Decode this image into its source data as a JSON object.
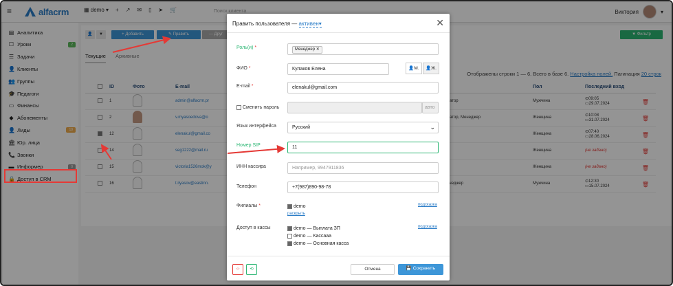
{
  "topbar": {
    "logo_text": "alfacrm",
    "branch": "demo",
    "branch_caret": "▾",
    "tools": [
      "+",
      "↗",
      "✉",
      "▯",
      "➤",
      "🛒"
    ],
    "search_placeholder": "Поиск клиента",
    "user_name": "Виктория",
    "user_caret": "▾"
  },
  "sidebar": {
    "items": [
      {
        "icon": "▤",
        "label": "Аналитика"
      },
      {
        "icon": "☐",
        "label": "Уроки",
        "badge": "2",
        "badge_color": "#5cb85c"
      },
      {
        "icon": "☰",
        "label": "Задачи"
      },
      {
        "icon": "👤",
        "label": "Клиенты"
      },
      {
        "icon": "👥",
        "label": "Группы"
      },
      {
        "icon": "🎓",
        "label": "Педагоги"
      },
      {
        "icon": "▭",
        "label": "Финансы"
      },
      {
        "icon": "◆",
        "label": "Абонементы"
      },
      {
        "icon": "👤",
        "label": "Лиды",
        "badge": "19",
        "badge_color": "#f0ad4e"
      },
      {
        "icon": "🏛",
        "label": "Юр. лица"
      },
      {
        "icon": "📞",
        "label": "Звонки"
      },
      {
        "icon": "▬",
        "label": "Информер",
        "badge": "0",
        "badge_color": "#999"
      },
      {
        "icon": "🔒",
        "label": "Доступ в CRM"
      }
    ]
  },
  "toolbar": {
    "add_label": "+ Добавить",
    "edit_label": "✎ Править",
    "other_label": "— Друг",
    "filter_label": "▼ Фильтр"
  },
  "tabs": {
    "current": "Текущие",
    "archived": "Архивные"
  },
  "rows_info": {
    "text": "Отображены строки 1 — 6. Всего в базе 6.",
    "fields_link": "Настройка полей.",
    "pagination_text": "Пагинация",
    "pagination_link": "20 строк"
  },
  "table": {
    "headers": {
      "id": "ID",
      "photo": "Фото",
      "email": "E-mail",
      "sex": "Пол",
      "last_login": "Последний вход"
    },
    "rows": [
      {
        "id": "1",
        "email": "admin@alfacrm.pr",
        "role": "стратор",
        "sex": "Мужчина",
        "login_time": "⊙09:05",
        "login_date": "▭29.07.2024",
        "checked": false,
        "photo": false
      },
      {
        "id": "2",
        "email": "v.myasoedova@o",
        "role": "стратор, Менеджер",
        "sex": "Женщина",
        "login_time": "⊙10:08",
        "login_date": "▭31.07.2024",
        "checked": false,
        "photo": true
      },
      {
        "id": "12",
        "email": "elenakul@gmail.co",
        "role": "",
        "sex": "Женщина",
        "login_time": "⊙07:40",
        "login_date": "▭28.06.2024",
        "checked": true,
        "photo": false
      },
      {
        "id": "14",
        "email": "seg1222@mail.ru",
        "role": "",
        "sex": "Женщина",
        "login_time": "",
        "login_date": "(не задано)",
        "checked": false,
        "photo": false
      },
      {
        "id": "15",
        "email": "victoria1526mok@y",
        "role": "",
        "sex": "Женщина",
        "login_time": "",
        "login_date": "(не задано)",
        "checked": false,
        "photo": false
      },
      {
        "id": "16",
        "email": "t.ilyasov@eastinn.",
        "role": "Менеджер",
        "sex": "Мужчина",
        "login_time": "⊙12:30",
        "login_date": "▭15.07.2024",
        "checked": false,
        "photo": false
      }
    ]
  },
  "modal": {
    "title": "Править пользователя —",
    "status": "активен",
    "status_caret": "▾",
    "close": "✕",
    "roles_label": "Роль(и)",
    "roles_tag": "Менеджер",
    "fio_label": "ФИО",
    "fio_value": "Кулаков Елена",
    "sex_m": "👤М.",
    "sex_f": "👤Ж.",
    "email_label": "E-mail",
    "email_value": "elenakul@gmail.com",
    "change_password_label": "Сменить пароль",
    "password_auto": "авто",
    "language_label": "Язык интерфейса",
    "language_value": "Русский",
    "sip_label": "Номер SIP",
    "sip_value": "11",
    "inn_label": "ИНН кассира",
    "inn_placeholder": "Например, 9947911836",
    "phone_label": "Телефон",
    "phone_value": "+7(987)890-98-78",
    "branches_label": "Филиалы",
    "branch_item": "demo",
    "expand_link": "раскрыть",
    "hint_link": "подсказка",
    "cash_label": "Доступ в кассы",
    "cash_items": [
      {
        "label": "demo — Выплата ЗП",
        "checked": true
      },
      {
        "label": "demo — Кассааа",
        "checked": false
      },
      {
        "label": "demo — Основная касса",
        "checked": true
      }
    ],
    "cancel_label": "Отмена",
    "save_label": "💾 Сохранить",
    "colors": {
      "accent": "#2a7cc7",
      "save": "#3d96d8",
      "green": "#2bb673",
      "red": "#e53935"
    }
  }
}
